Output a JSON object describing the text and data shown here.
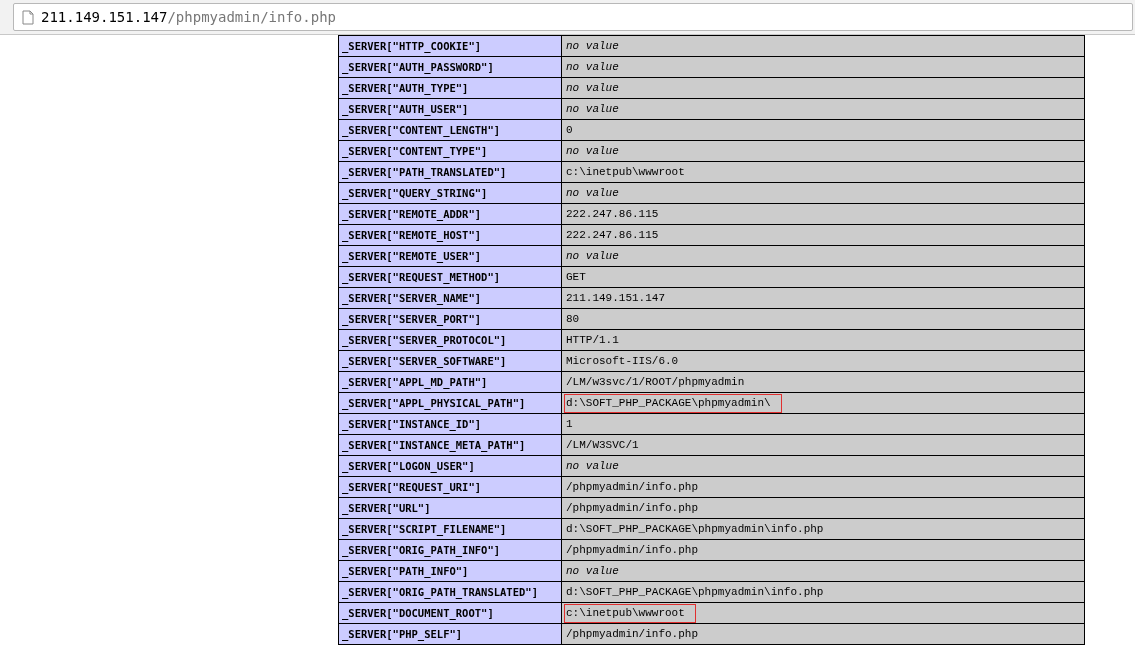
{
  "address_bar": {
    "host": "211.149.151.147",
    "path": "/phpmyadmin/info.php"
  },
  "table": {
    "rows": [
      {
        "key": "_SERVER[\"HTTP_COOKIE\"]",
        "value": "no value",
        "kind": "empty",
        "highlighted": false
      },
      {
        "key": "_SERVER[\"AUTH_PASSWORD\"]",
        "value": "no value",
        "kind": "empty",
        "highlighted": false
      },
      {
        "key": "_SERVER[\"AUTH_TYPE\"]",
        "value": "no value",
        "kind": "empty",
        "highlighted": false
      },
      {
        "key": "_SERVER[\"AUTH_USER\"]",
        "value": "no value",
        "kind": "empty",
        "highlighted": false
      },
      {
        "key": "_SERVER[\"CONTENT_LENGTH\"]",
        "value": "0",
        "kind": "text",
        "highlighted": false
      },
      {
        "key": "_SERVER[\"CONTENT_TYPE\"]",
        "value": "no value",
        "kind": "empty",
        "highlighted": false
      },
      {
        "key": "_SERVER[\"PATH_TRANSLATED\"]",
        "value": "c:\\inetpub\\wwwroot",
        "kind": "text",
        "highlighted": false
      },
      {
        "key": "_SERVER[\"QUERY_STRING\"]",
        "value": "no value",
        "kind": "empty",
        "highlighted": false
      },
      {
        "key": "_SERVER[\"REMOTE_ADDR\"]",
        "value": "222.247.86.115",
        "kind": "text",
        "highlighted": false
      },
      {
        "key": "_SERVER[\"REMOTE_HOST\"]",
        "value": "222.247.86.115",
        "kind": "text",
        "highlighted": false
      },
      {
        "key": "_SERVER[\"REMOTE_USER\"]",
        "value": "no value",
        "kind": "empty",
        "highlighted": false
      },
      {
        "key": "_SERVER[\"REQUEST_METHOD\"]",
        "value": "GET",
        "kind": "text",
        "highlighted": false
      },
      {
        "key": "_SERVER[\"SERVER_NAME\"]",
        "value": "211.149.151.147",
        "kind": "text",
        "highlighted": false
      },
      {
        "key": "_SERVER[\"SERVER_PORT\"]",
        "value": "80",
        "kind": "text",
        "highlighted": false
      },
      {
        "key": "_SERVER[\"SERVER_PROTOCOL\"]",
        "value": "HTTP/1.1",
        "kind": "text",
        "highlighted": false
      },
      {
        "key": "_SERVER[\"SERVER_SOFTWARE\"]",
        "value": "Microsoft-IIS/6.0",
        "kind": "text",
        "highlighted": false
      },
      {
        "key": "_SERVER[\"APPL_MD_PATH\"]",
        "value": "/LM/w3svc/1/ROOT/phpmyadmin",
        "kind": "text",
        "highlighted": false
      },
      {
        "key": "_SERVER[\"APPL_PHYSICAL_PATH\"]",
        "value": "d:\\SOFT_PHP_PACKAGE\\phpmyadmin\\",
        "kind": "text",
        "highlighted": true
      },
      {
        "key": "_SERVER[\"INSTANCE_ID\"]",
        "value": "1",
        "kind": "text",
        "highlighted": false
      },
      {
        "key": "_SERVER[\"INSTANCE_META_PATH\"]",
        "value": "/LM/W3SVC/1",
        "kind": "text",
        "highlighted": false
      },
      {
        "key": "_SERVER[\"LOGON_USER\"]",
        "value": "no value",
        "kind": "empty",
        "highlighted": false
      },
      {
        "key": "_SERVER[\"REQUEST_URI\"]",
        "value": "/phpmyadmin/info.php",
        "kind": "text",
        "highlighted": false
      },
      {
        "key": "_SERVER[\"URL\"]",
        "value": "/phpmyadmin/info.php",
        "kind": "text",
        "highlighted": false
      },
      {
        "key": "_SERVER[\"SCRIPT_FILENAME\"]",
        "value": "d:\\SOFT_PHP_PACKAGE\\phpmyadmin\\info.php",
        "kind": "text",
        "highlighted": false
      },
      {
        "key": "_SERVER[\"ORIG_PATH_INFO\"]",
        "value": "/phpmyadmin/info.php",
        "kind": "text",
        "highlighted": false
      },
      {
        "key": "_SERVER[\"PATH_INFO\"]",
        "value": "no value",
        "kind": "empty",
        "highlighted": false
      },
      {
        "key": "_SERVER[\"ORIG_PATH_TRANSLATED\"]",
        "value": "d:\\SOFT_PHP_PACKAGE\\phpmyadmin\\info.php",
        "kind": "text",
        "highlighted": false
      },
      {
        "key": "_SERVER[\"DOCUMENT_ROOT\"]",
        "value": "c:\\inetpub\\wwwroot",
        "kind": "text",
        "highlighted": true
      },
      {
        "key": "_SERVER[\"PHP_SELF\"]",
        "value": "/phpmyadmin/info.php",
        "kind": "text",
        "highlighted": false
      }
    ]
  }
}
